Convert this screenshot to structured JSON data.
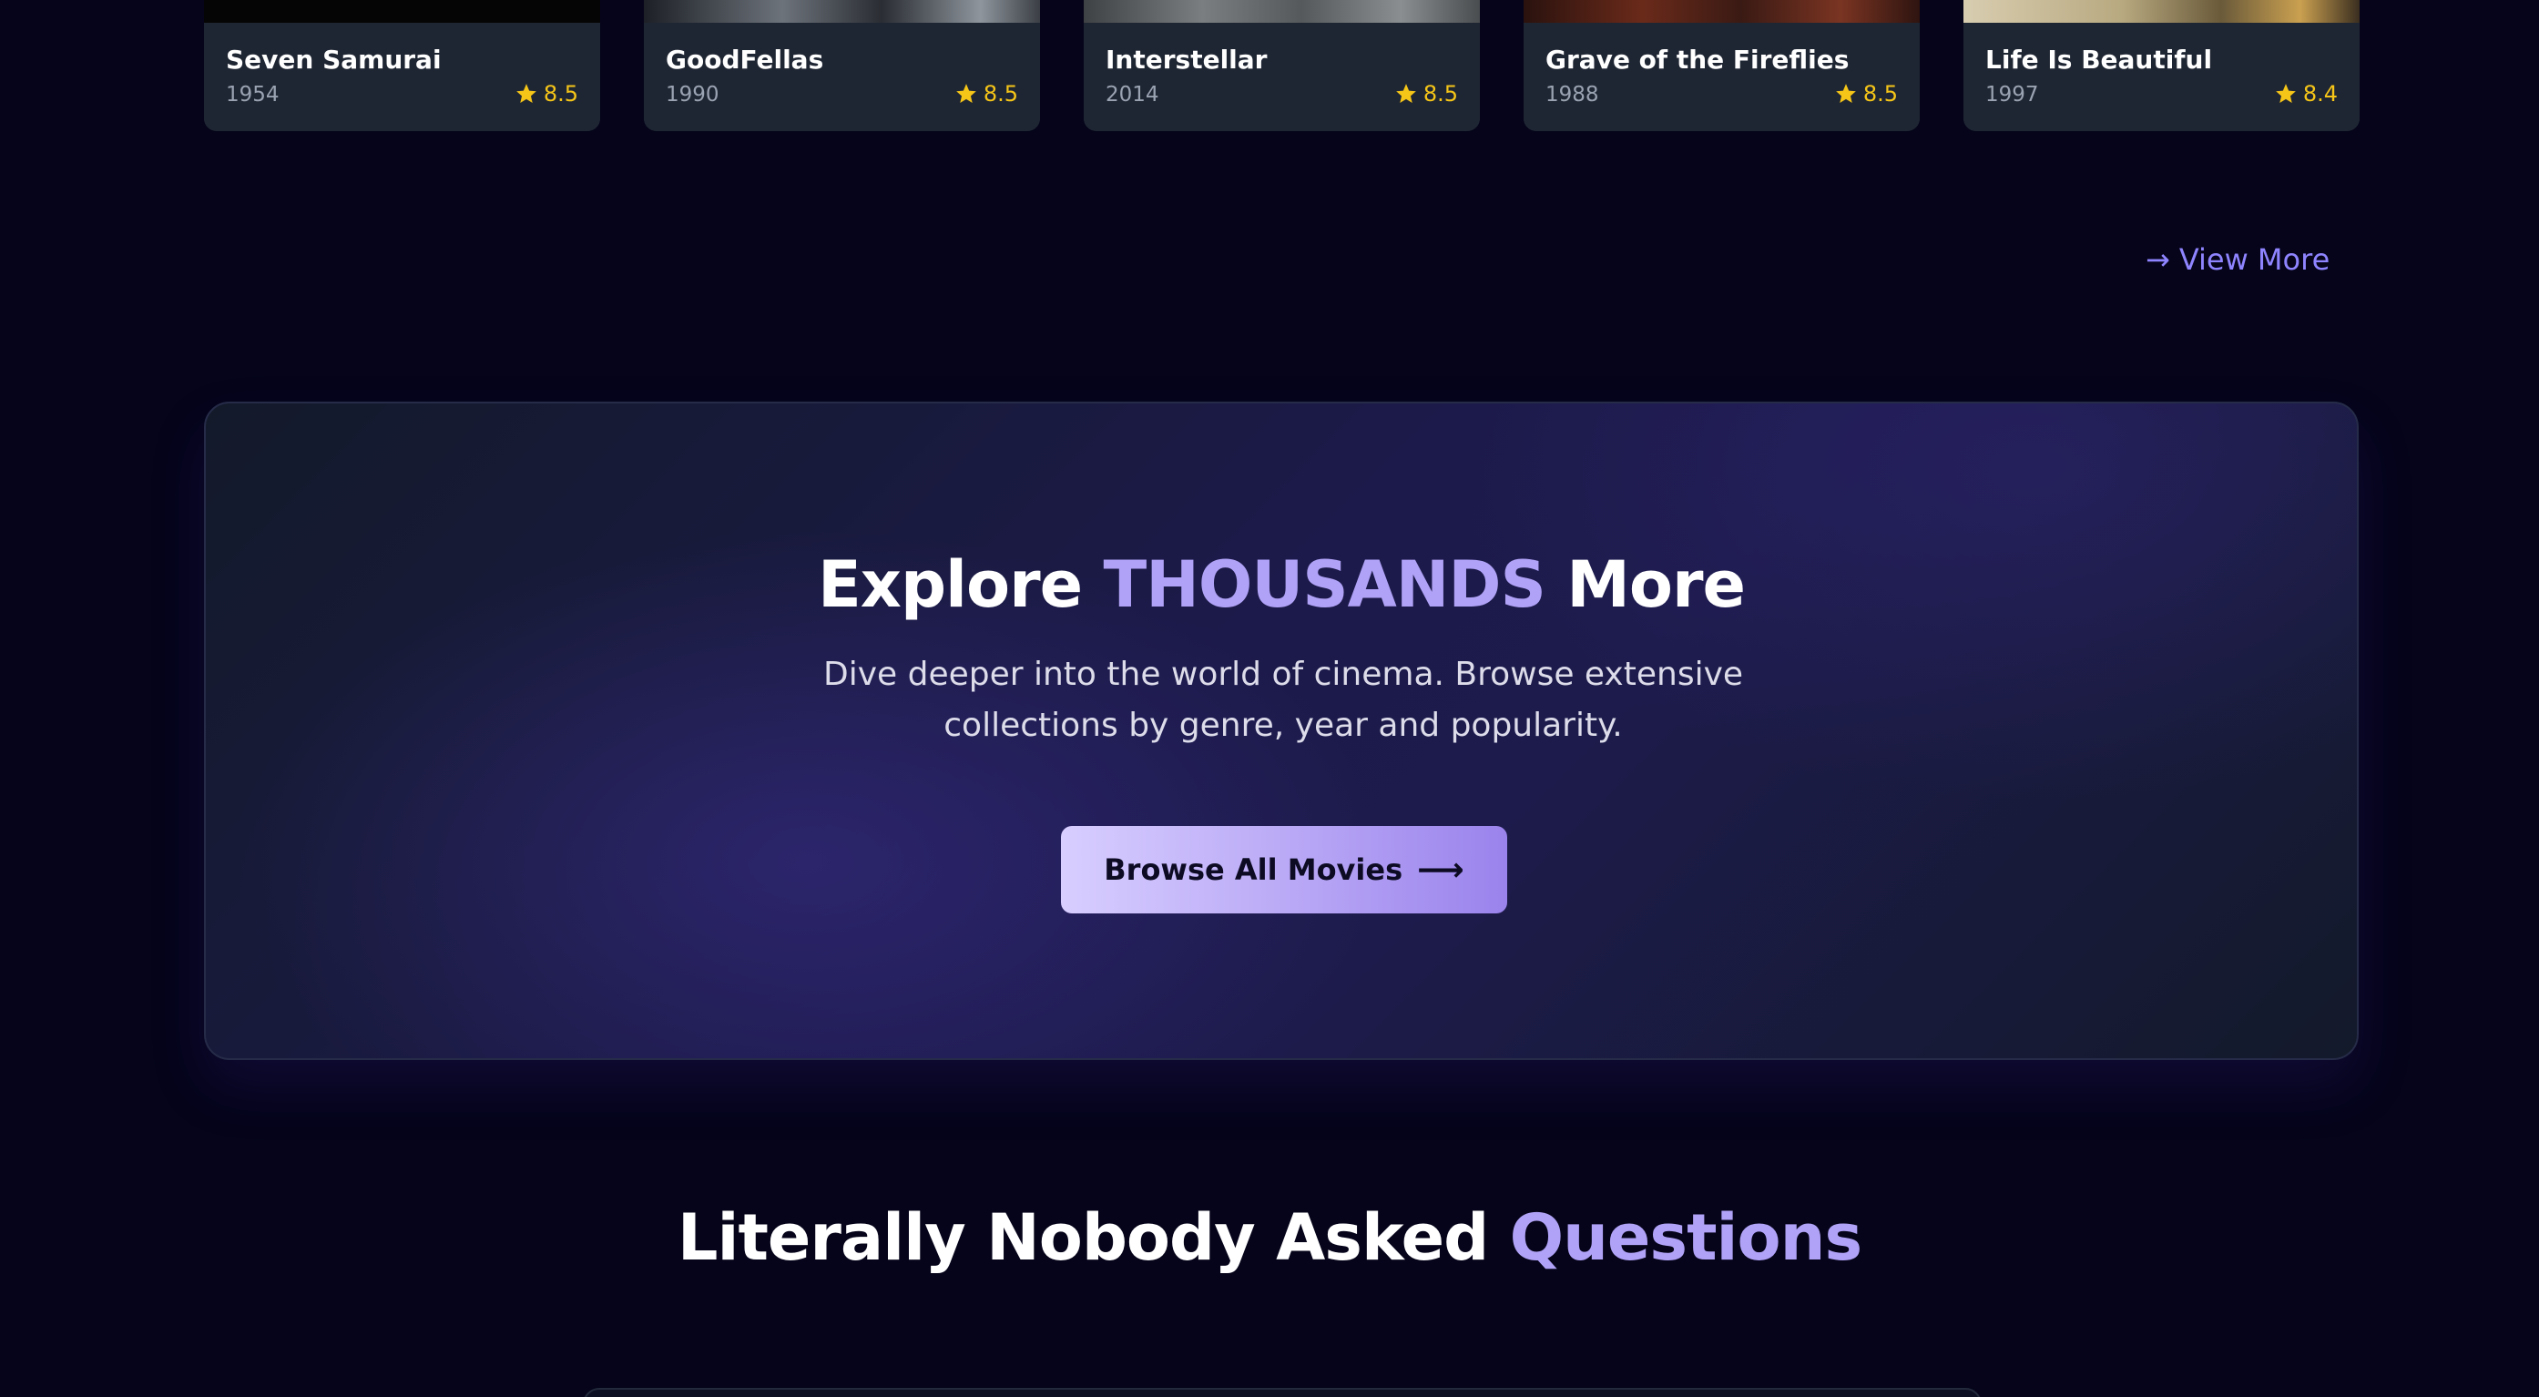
{
  "movies": [
    {
      "title": "Seven Samurai",
      "year": "1954",
      "rating": "8.5",
      "poster_color": "#050505"
    },
    {
      "title": "GoodFellas",
      "year": "1990",
      "rating": "8.5",
      "poster_color": "#2a2d33"
    },
    {
      "title": "Interstellar",
      "year": "2014",
      "rating": "8.5",
      "poster_color": "#5b5e5f"
    },
    {
      "title": "Grave of the Fireflies",
      "year": "1988",
      "rating": "8.5",
      "poster_color": "#3a1a14"
    },
    {
      "title": "Life Is Beautiful",
      "year": "1997",
      "rating": "8.4",
      "poster_color": "#8a7a5a"
    }
  ],
  "view_more": {
    "label": "View More"
  },
  "explore": {
    "title_part1": "Explore ",
    "title_accent": "THOUSANDS",
    "title_part2": " More",
    "description": "Dive deeper into the world of cinema. Browse extensive collections by genre, year and popularity.",
    "button_label": "Browse All Movies"
  },
  "faq": {
    "title_part1": "Literally Nobody Asked ",
    "title_accent": "Questions"
  },
  "colors": {
    "background": "#05041a",
    "accent": "#b0a2f7",
    "link": "#8f84ff",
    "rating": "#f5c518",
    "card": "#1f2633"
  }
}
